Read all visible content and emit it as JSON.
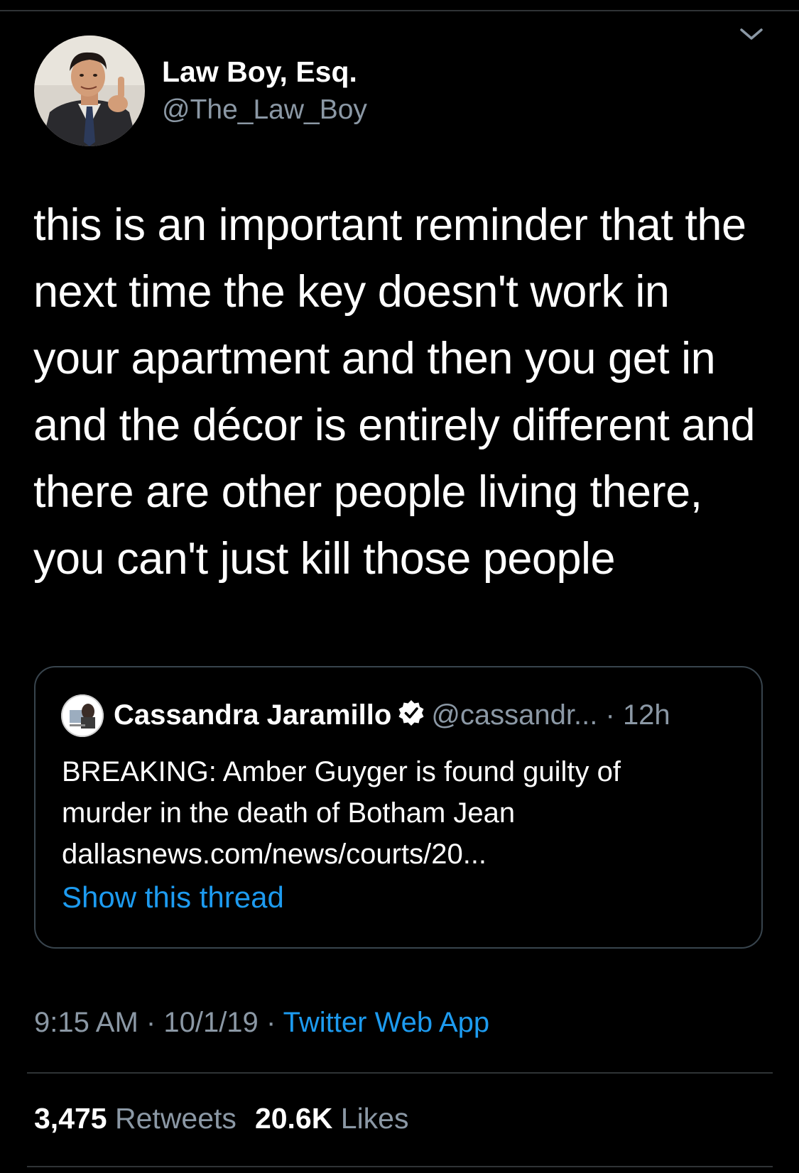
{
  "author": {
    "display_name": "Law Boy, Esq.",
    "handle": "@The_Law_Boy"
  },
  "icons": {
    "more": "chevron-down-icon",
    "verified": "verified-badge-icon"
  },
  "tweet": {
    "lines": [
      "this is an important reminder that the",
      "next time the key doesn't work in",
      "your apartment and then you get in",
      "and the décor is entirely different and",
      "there are other people living there,",
      "you can't just kill those people"
    ]
  },
  "quote": {
    "name": "Cassandra Jaramillo",
    "handle": "@cassandr...",
    "separator": "·",
    "time": "12h",
    "lines": [
      "BREAKING: Amber Guyger is found guilty of",
      "murder in the death of Botham Jean",
      "dallasnews.com/news/courts/20..."
    ],
    "show_thread": "Show this thread"
  },
  "meta": {
    "time": "9:15 AM",
    "sep1": "·",
    "date": "10/1/19",
    "sep2": "·",
    "source": "Twitter Web App"
  },
  "stats": {
    "retweets_count": "3,475",
    "retweets_label": "Retweets",
    "likes_count": "20.6K",
    "likes_label": "Likes"
  },
  "colors": {
    "background": "#000000",
    "text": "#ffffff",
    "secondary": "#8b98a5",
    "link": "#1d9bf0",
    "border": "#38444d"
  }
}
